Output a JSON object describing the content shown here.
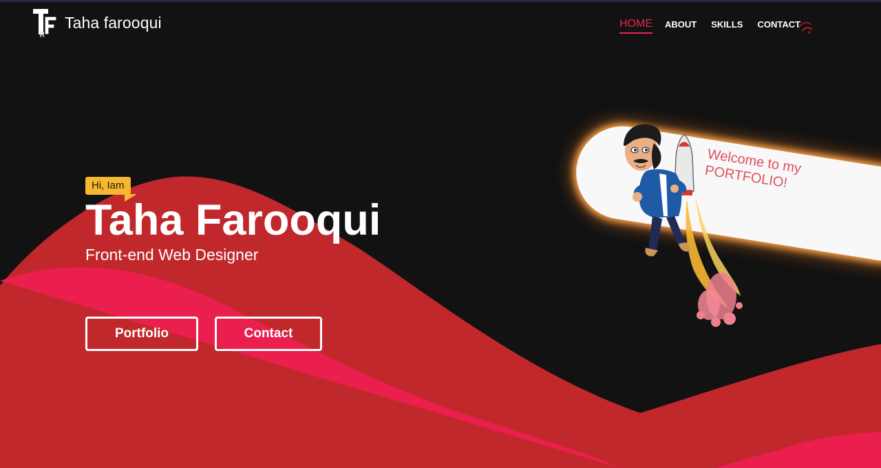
{
  "header": {
    "brand_name": "Taha farooqui",
    "nav": [
      {
        "label": "HOME",
        "active": true
      },
      {
        "label": "ABOUT",
        "active": false
      },
      {
        "label": "SKILLS",
        "active": false
      },
      {
        "label": "CONTACT",
        "active": false
      }
    ]
  },
  "hero": {
    "greeting": "Hi, Iam",
    "name": "Taha Farooqui",
    "role": "Front-end Web Designer",
    "buttons": {
      "portfolio": "Portfolio",
      "contact": "Contact"
    }
  },
  "welcome": {
    "line1": "Welcome to my",
    "line2": "PORTFOLIO!"
  },
  "icons": {
    "brand_logo": "tf-monogram-icon",
    "nav_sparkle": "sparkle-icon",
    "avatar": "jetpack-avatar"
  },
  "colors": {
    "background": "#121212",
    "accent": "#e8244f",
    "wave_dark": "#c0282c",
    "wave_bright": "#eb1f4d",
    "greeting_bg": "#f5b82e",
    "welcome_text": "#e0505f"
  }
}
